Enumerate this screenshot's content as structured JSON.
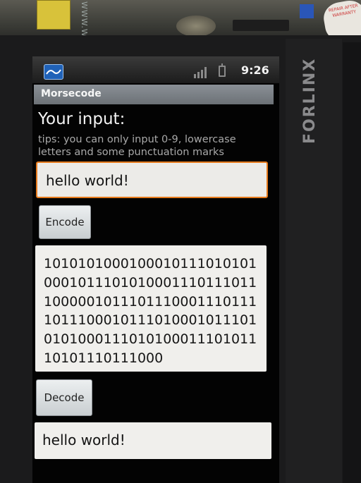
{
  "backdrop": {
    "board_label": "WWW.WI",
    "sticker_text": "REPAIR AFTER WARRANTY",
    "device_brand": "FORLINX"
  },
  "statusbar": {
    "time": "9:26",
    "app_icon": "app-notification-icon",
    "signal_icon": "signal-bars-icon",
    "battery_icon": "battery-icon"
  },
  "app": {
    "title": "Morsecode",
    "heading": "Your input:",
    "tips": "tips: you can only input 0-9, lowercase letters and some punctuation marks",
    "input_value": "hello world!",
    "encode_label": "Encode",
    "encoded_output": "1010101000100010111010101\n0001011101010001110111011\n1000001011101110001110111\n1011100010111010001011101\n0101000111010100011101011\n10101110111000",
    "decode_label": "Decode",
    "decoded_output": "hello world!"
  },
  "colors": {
    "input_focus_border": "#e67a1c",
    "titlebar": "#7d8287",
    "screen_bg": "#030303"
  }
}
